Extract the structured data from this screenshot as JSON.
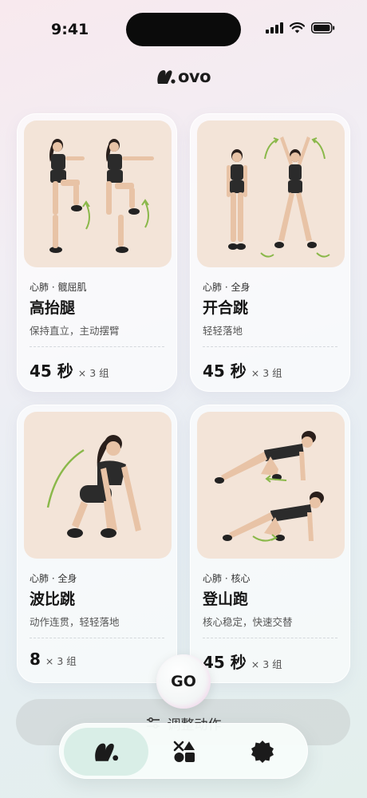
{
  "status_bar": {
    "time": "9:41"
  },
  "app": {
    "logo_text": "ovo"
  },
  "exercises": [
    {
      "tag": "心肺 · 髋屈肌",
      "name": "高抬腿",
      "tip": "保持直立，主动摆臂",
      "amount": "45 秒",
      "sets": "× 3 组"
    },
    {
      "tag": "心肺 · 全身",
      "name": "开合跳",
      "tip": "轻轻落地",
      "amount": "45 秒",
      "sets": "× 3 组"
    },
    {
      "tag": "心肺 · 全身",
      "name": "波比跳",
      "tip": "动作连贯，轻轻落地",
      "amount": "8",
      "sets": "× 3 组"
    },
    {
      "tag": "心肺 · 核心",
      "name": "登山跑",
      "tip": "核心稳定，快速交替",
      "amount": "45 秒",
      "sets": "× 3 组"
    }
  ],
  "actions": {
    "go_label": "GO",
    "adjust_label": "调整动作"
  },
  "tabbar": {
    "items": [
      {
        "icon": "ovo-logo-icon",
        "active": true
      },
      {
        "icon": "shapes-icon",
        "active": false
      },
      {
        "icon": "badge-icon",
        "active": false
      }
    ]
  },
  "colors": {
    "accent_green": "#d9eee7",
    "card_image_bg": "#f3e4d8",
    "arrow_green": "#8ab84a"
  }
}
